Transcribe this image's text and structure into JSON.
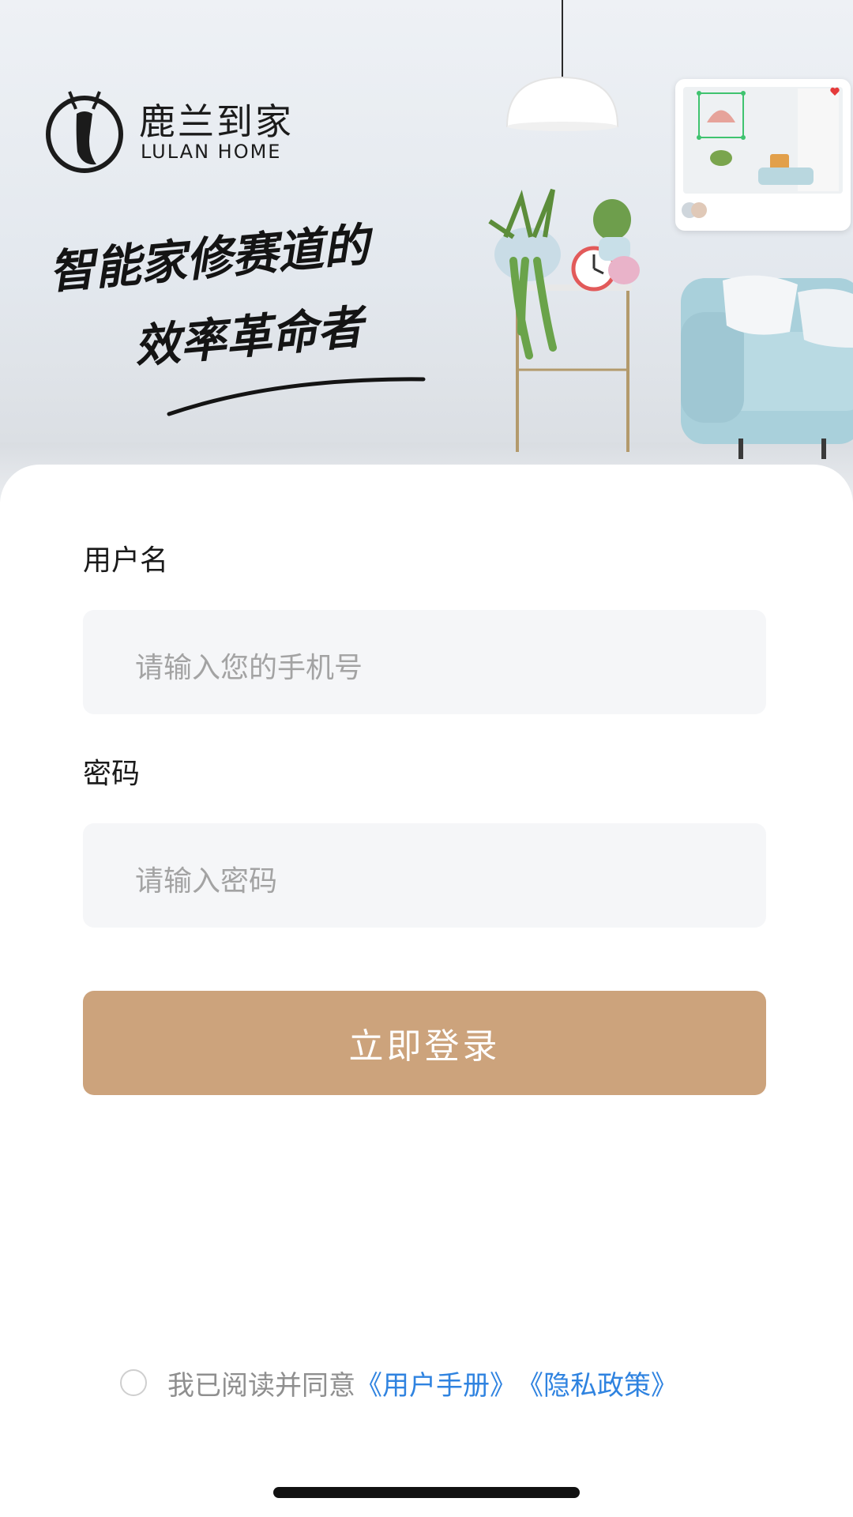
{
  "brand": {
    "name_cn": "鹿兰到家",
    "name_en": "LULAN HOME",
    "logo_icon": "deer-logo-icon"
  },
  "hero": {
    "slogan_line1": "智能家修赛道的",
    "slogan_line2": "效率革命者"
  },
  "form": {
    "username_label": "用户名",
    "username_placeholder": "请输入您的手机号",
    "password_label": "密码",
    "password_placeholder": "请输入密码",
    "login_button": "立即登录"
  },
  "agreement": {
    "prefix": "我已阅读并同意",
    "user_manual_link": "《用户手册》",
    "privacy_link": "《隐私政策》",
    "checked": false
  },
  "colors": {
    "accent": "#cca37c",
    "link": "#2f83e0",
    "input_bg": "#f5f6f8"
  }
}
